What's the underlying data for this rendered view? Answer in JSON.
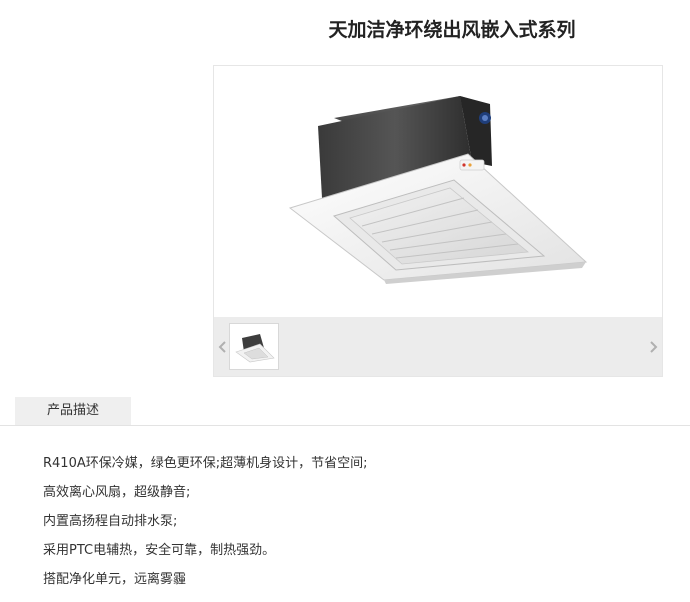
{
  "product": {
    "title": "天加洁净环绕出风嵌入式系列"
  },
  "gallery": {
    "main_image": "ceiling-cassette-unit",
    "thumbnails": [
      "ceiling-cassette-unit"
    ],
    "prev_icon": "chevron-left-icon",
    "next_icon": "chevron-right-icon"
  },
  "tabs": [
    {
      "label": "产品描述",
      "active": true
    }
  ],
  "description": [
    "R410A环保冷媒，绿色更环保;超薄机身设计，节省空间;",
    "高效离心风扇，超级静音;",
    "内置高扬程自动排水泵;",
    "采用PTC电辅热，安全可靠，制热强劲。",
    "搭配净化单元，远离雾霾"
  ],
  "colors": {
    "title": "#222222",
    "text": "#333333",
    "tab_bg": "#efefef",
    "thumb_strip_bg": "#ececec"
  }
}
